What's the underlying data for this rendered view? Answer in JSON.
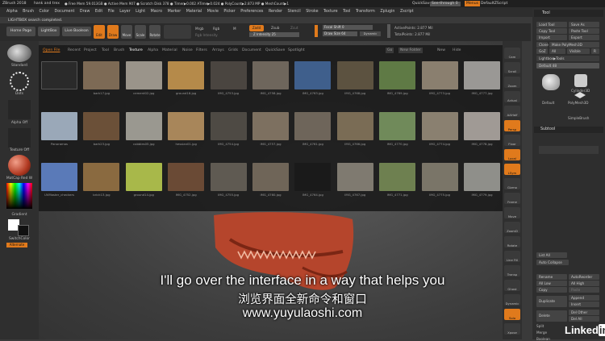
{
  "title_bar": {
    "app": "ZBrush 2018",
    "doc": "hank and trex",
    "stats": "● Free Mem 59.013GB ● Active Mem 907 ● Scratch Disk 378 ● Timer▶0.002 ATime▶0.024 ● PolyCount▶2.873 MP ● MeshCount▶1",
    "quicksave": "QuickSave",
    "see_through": "See-through  0",
    "menus": "Menus",
    "script": "DefaultZScript"
  },
  "menu": [
    "Alpha",
    "Brush",
    "Color",
    "Document",
    "Draw",
    "Edit",
    "File",
    "Layer",
    "Light",
    "Macro",
    "Marker",
    "Material",
    "Movie",
    "Picker",
    "Preferences",
    "Render",
    "Stencil",
    "Stroke",
    "Texture",
    "Tool",
    "Transform",
    "Zplugin",
    "Zscript"
  ],
  "status_message": "LIGHTBOX search completed.",
  "toolbar": {
    "home_page": "Home Page",
    "lightbox": "LightBox",
    "live_boolean": "Live Boolean",
    "edit": "Edit",
    "draw": "Draw",
    "move": "Move",
    "scale": "Scale",
    "rotate": "Rotate",
    "mrgb": "Mrgb",
    "rgb": "Rgb",
    "m": "M",
    "rgb_intensity": "Rgb Intensity",
    "zadd": "Zadd",
    "zsub": "Zsub",
    "zcut": "Zcut",
    "z_intensity": "Z Intensity",
    "z_intensity_val": "25",
    "focal_shift": "Focal Shift",
    "focal_val": "0",
    "draw_size": "Draw Size",
    "draw_size_val": "64",
    "dynamic": "Dynamic",
    "active_points": "ActivePoints: 2.877 Mil",
    "total_points": "TotalPoints: 2.877 Mil"
  },
  "left_shelf": {
    "standard": "Standard",
    "dots": "Dots",
    "alpha_off": "Alpha Off",
    "texture_off": "Texture Off",
    "matcap": "MatCap Red W",
    "gradient": "Gradient",
    "switch_color": "SwitchColor",
    "alternate": "Alternate"
  },
  "lightbox": {
    "tabs": [
      "Open File",
      "Recent",
      "Project",
      "Tool",
      "Brush",
      "Texture",
      "Alpha",
      "Material",
      "Noise",
      "Filters",
      "Arrays",
      "Grids",
      "Document",
      "QuickSave",
      "Spotlight"
    ],
    "active_tab": "Texture",
    "right_tabs": [
      "Go",
      "New Folder",
      "New",
      "Hide"
    ],
    "items": [
      {
        "name": "",
        "color": "#2a2a2a"
      },
      {
        "name": "bark17.jpg",
        "color": "#7d6a55"
      },
      {
        "name": "cement02.jpg",
        "color": "#9a948a"
      },
      {
        "name": "ground16.jpg",
        "color": "#b58a4a"
      },
      {
        "name": "IMG_4753.jpg",
        "color": "#4a4540"
      },
      {
        "name": "IMG_4758.jpg",
        "color": "#6e665c"
      },
      {
        "name": "IMG_4763.jpg",
        "color": "#3f5f8c"
      },
      {
        "name": "IMG_4768.jpg",
        "color": "#5c5240"
      },
      {
        "name": "IMG_4769.jpg",
        "color": "#5f7a45"
      },
      {
        "name": "IMG_4773.jpg",
        "color": "#8a7f6f"
      },
      {
        "name": "IMG_4777.jpg",
        "color": "#9a9895"
      },
      {
        "name": "Panoramas",
        "color": "#9aa8b8"
      },
      {
        "name": "bark23.jpg",
        "color": "#6b5038"
      },
      {
        "name": "cobbles05.jpg",
        "color": "#9a9890"
      },
      {
        "name": "hessian01.jpg",
        "color": "#a8865a"
      },
      {
        "name": "IMG_4754.jpg",
        "color": "#4e4a44"
      },
      {
        "name": "IMG_4757.jpg",
        "color": "#7d7060"
      },
      {
        "name": "IMG_4761.jpg",
        "color": "#6e655a"
      },
      {
        "name": "IMG_4766.jpg",
        "color": "#7a6c55"
      },
      {
        "name": "IMG_4770.jpg",
        "color": "#708a5a"
      },
      {
        "name": "IMG_4774.jpg",
        "color": "#8a8070"
      },
      {
        "name": "IMG_4778.jpg",
        "color": "#a09a95"
      },
      {
        "name": "UVMaster_checkers",
        "color": "#5a7ab8"
      },
      {
        "name": "brick13.jpg",
        "color": "#8a6a40"
      },
      {
        "name": "ground14.jpg",
        "color": "#a8b84a"
      },
      {
        "name": "IMG_4752.jpg",
        "color": "#6a4a35"
      },
      {
        "name": "IMG_4755.jpg",
        "color": "#5f5a52"
      },
      {
        "name": "IMG_4760.jpg",
        "color": "#6f6558"
      },
      {
        "name": "IMG_4764.jpg",
        "color": "#1a1a1a"
      },
      {
        "name": "IMG_4767.jpg",
        "color": "#7f7a70"
      },
      {
        "name": "IMG_4771.jpg",
        "color": "#6e8050"
      },
      {
        "name": "IMG_4775.jpg",
        "color": "#7a7568"
      },
      {
        "name": "IMG_4779.jpg",
        "color": "#8f8f8a"
      }
    ]
  },
  "right_shelf": [
    "Cam",
    "Scroll",
    "Zoom",
    "Actual",
    "AAHalf",
    "Persp",
    "Floor",
    "Local",
    "LSym",
    "Gizmo",
    "Frame",
    "Move",
    "ZoomD",
    "Rotate",
    "Line Fill",
    "Transp",
    "Ghost",
    "Dynamic",
    "Solo",
    "Xpose"
  ],
  "tool_panel": {
    "title": "Tool",
    "load_tool": "Load Tool",
    "save_as": "Save As",
    "copy_tool": "Copy Tool",
    "paste_tool": "Paste Tool",
    "import": "Import",
    "export": "Export",
    "clone": "Clone",
    "make_polymesh": "Make PolyMesh3D",
    "goz": "GoZ",
    "all": "All",
    "visible": "Visible",
    "r": "R",
    "lightbox_tools": "Lightbox▶Tools",
    "default_label": "Default",
    "default_val": "48",
    "cylinder": "Cylinder3D",
    "polymesh": "PolyMesh3D",
    "simplebrush": "SimpleBrush",
    "subtool": "Subtool",
    "list_all": "List All",
    "auto_collapse": "Auto Collapse",
    "rename": "Rename",
    "autoreorder": "AutoReorder",
    "all_low": "All Low",
    "all_high": "All High",
    "copy": "Copy",
    "paste": "Paste",
    "duplicate": "Duplicate",
    "append": "Append",
    "insert": "Insert",
    "delete": "Delete",
    "del_other": "Del Other",
    "del_all": "Del All",
    "split": "Split",
    "merge": "Merge",
    "boolean": "Boolean",
    "linkedin": "LinkedIn"
  },
  "subtitles": {
    "en": "I'll go over the interface in a way that helps you",
    "zh": "浏览界面全新命令和窗口",
    "url": "www.yuyulaoshi.com"
  }
}
